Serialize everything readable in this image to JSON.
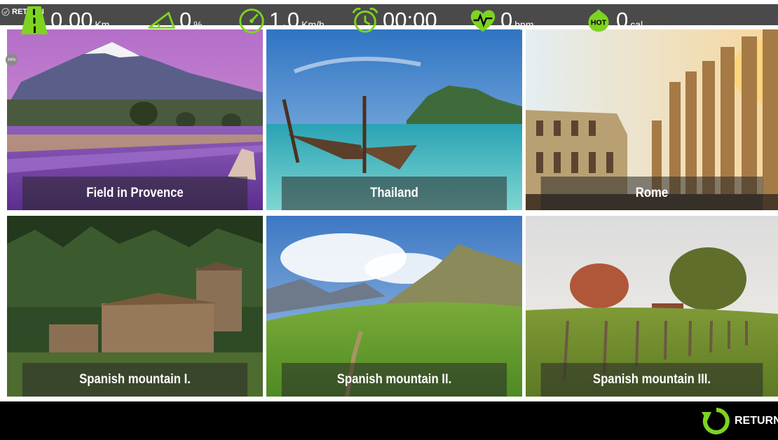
{
  "header": {
    "return_label": "RETURN"
  },
  "progress_badge": "34%",
  "scenes": [
    {
      "title": "Field in Provence"
    },
    {
      "title": "Thailand"
    },
    {
      "title": "Rome"
    },
    {
      "title": "Spanish mountain I."
    },
    {
      "title": "Spanish mountain II."
    },
    {
      "title": "Spanish mountain III."
    }
  ],
  "stats": {
    "distance": {
      "value": "0.00",
      "unit": "Km",
      "icon": "road-icon"
    },
    "incline": {
      "value": "0",
      "unit": "%",
      "icon": "incline-icon"
    },
    "speed": {
      "value": "1.0",
      "unit": "Km/h",
      "icon": "speedometer-icon"
    },
    "time": {
      "value": "00:00",
      "icon": "alarm-clock-icon"
    },
    "heart_rate": {
      "value": "0",
      "unit": "bpm",
      "icon": "heart-pulse-icon"
    },
    "calories": {
      "value": "0",
      "unit": "cal",
      "icon": "hot-flame-icon"
    }
  },
  "footer": {
    "return_label": "RETURN"
  },
  "colors": {
    "accent": "#7ED321",
    "bar": "#000000",
    "header": "#4a4a4a"
  }
}
